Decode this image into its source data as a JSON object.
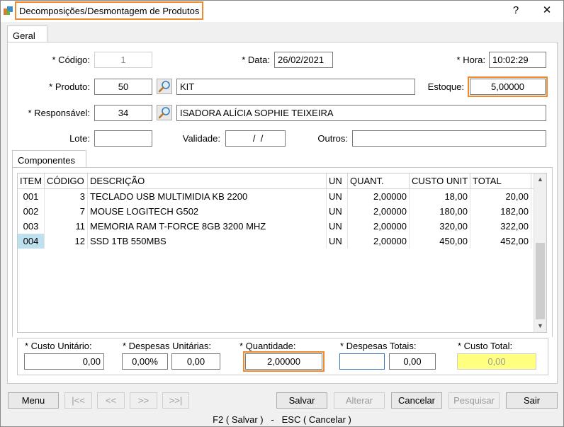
{
  "window": {
    "title": "Decomposições/Desmontagem de Produtos",
    "help": "?",
    "close": "✕"
  },
  "tabs": {
    "geral": "Geral",
    "componentes": "Componentes"
  },
  "form": {
    "codigo_label": "* Código:",
    "codigo_value": "1",
    "data_label": "* Data:",
    "data_value": "26/02/2021",
    "hora_label": "* Hora:",
    "hora_value": "10:02:29",
    "produto_label": "* Produto:",
    "produto_code": "50",
    "produto_name": "KIT",
    "estoque_label": "Estoque:",
    "estoque_value": "5,00000",
    "responsavel_label": "* Responsável:",
    "responsavel_code": "34",
    "responsavel_name": "ISADORA ALÍCIA SOPHIE TEIXEIRA",
    "lote_label": "Lote:",
    "lote_value": "",
    "validade_label": "Validade:",
    "validade_value": "  /  /",
    "outros_label": "Outros:",
    "outros_value": ""
  },
  "grid": {
    "headers": [
      "ITEM",
      "CÓDIGO",
      "DESCRIÇÃO",
      "UN",
      "QUANT.",
      "CUSTO UNIT",
      "TOTAL"
    ],
    "rows": [
      [
        "001",
        "3",
        "TECLADO USB MULTIMIDIA KB 2200",
        "UN",
        "2,00000",
        "18,00",
        "20,00"
      ],
      [
        "002",
        "7",
        "MOUSE LOGITECH G502",
        "UN",
        "2,00000",
        "180,00",
        "182,00"
      ],
      [
        "003",
        "11",
        "MEMORIA RAM T-FORCE 8GB 3200 MHZ",
        "UN",
        "2,00000",
        "320,00",
        "322,00"
      ],
      [
        "004",
        "12",
        "SSD 1TB 550MBS",
        "UN",
        "2,00000",
        "450,00",
        "452,00"
      ]
    ],
    "scroll_up": "▲",
    "scroll_down": "▼"
  },
  "totals": {
    "custo_unitario_label": "* Custo Unitário:",
    "custo_unitario_value": "0,00",
    "despesas_unitarias_label": "* Despesas Unitárias:",
    "despesas_unitarias_pct": "0,00%",
    "despesas_unitarias_value": "0,00",
    "quantidade_label": "* Quantidade:",
    "quantidade_value": "2,00000",
    "despesas_totais_label": "* Despesas Totais:",
    "despesas_totais_input": "",
    "despesas_totais_value": "0,00",
    "custo_total_label": "* Custo Total:",
    "custo_total_value": "0,00"
  },
  "buttons": {
    "menu": "Menu",
    "first": "|<<",
    "prev": "<<",
    "next": ">>",
    "last": ">>|",
    "salvar": "Salvar",
    "alterar": "Alterar",
    "cancelar": "Cancelar",
    "pesquisar": "Pesquisar",
    "sair": "Sair"
  },
  "footer": "F2 ( Salvar )   -   ESC ( Cancelar )",
  "colors": {
    "highlight": "#f08a2c",
    "selected_cell": "#bfe0ef",
    "custo_total_bg": "#ffff80"
  }
}
